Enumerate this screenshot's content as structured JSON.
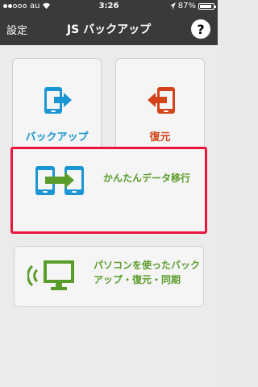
{
  "status_bar": {
    "carrier": "au",
    "time": "3:26",
    "battery": "87%",
    "battery_level": 0.87
  },
  "nav": {
    "settings_label": "設定",
    "title": "JS バックアップ",
    "help_label": "?"
  },
  "cards": {
    "backup": {
      "label": "バックアップ",
      "icon": "phone-export-icon",
      "color": "#1a96d4"
    },
    "restore": {
      "label": "復元",
      "icon": "phone-import-icon",
      "color": "#d4441a"
    },
    "transfer": {
      "label": "かんたんデータ移行",
      "icon": "phone-transfer-icon",
      "color": "#5a9c2a",
      "highlight": "#e8173d"
    },
    "pc": {
      "label_line1": "パソコンを使ったバック",
      "label_line2": "アップ・復元・同期",
      "icon": "pc-wireless-icon",
      "color": "#5a9c2a"
    }
  }
}
